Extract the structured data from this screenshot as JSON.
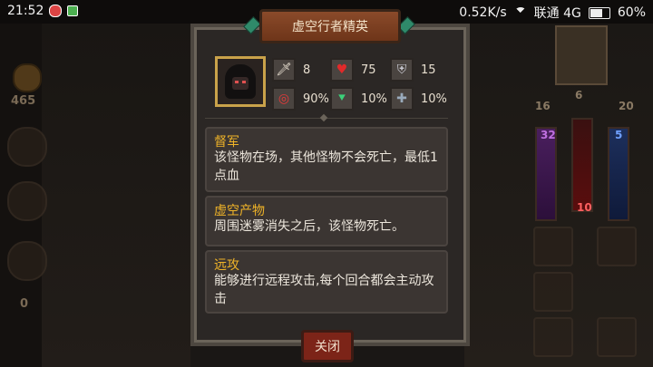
{
  "status_bar": {
    "time": "21:52",
    "network_speed": "0.52K/s",
    "carrier": "联通 4G",
    "battery": "60%"
  },
  "background_hud": {
    "gold": "465",
    "left_counter": "0",
    "hero_level": "6",
    "left_stat": "16",
    "right_stat": "20",
    "mana_value": "32",
    "hp_value": "10",
    "shield_value": "5"
  },
  "modal": {
    "title": "虚空行者精英",
    "stats": {
      "attack": "8",
      "hp": "75",
      "defense": "15",
      "hit_rate": "90%",
      "dodge": "10%",
      "armor": "10%"
    },
    "abilities": [
      {
        "title": "督军",
        "description": "该怪物在场，其他怪物不会死亡，最低1点血"
      },
      {
        "title": "虚空产物",
        "description": "周围迷雾消失之后，该怪物死亡。"
      },
      {
        "title": "远攻",
        "description": "能够进行远程攻击,每个回合都会主动攻击"
      }
    ],
    "close_label": "关闭"
  },
  "icons": {
    "attack": "sword-icon",
    "hp": "heart-icon",
    "defense": "shield-icon",
    "hit_rate": "target-icon",
    "dodge": "dodge-icon",
    "armor": "armor-shield-icon"
  },
  "colors": {
    "ability_title": "#f0b428",
    "title_banner": "#7a3d20",
    "close_button": "#7c2418",
    "portrait_frame": "#c9a24a"
  }
}
